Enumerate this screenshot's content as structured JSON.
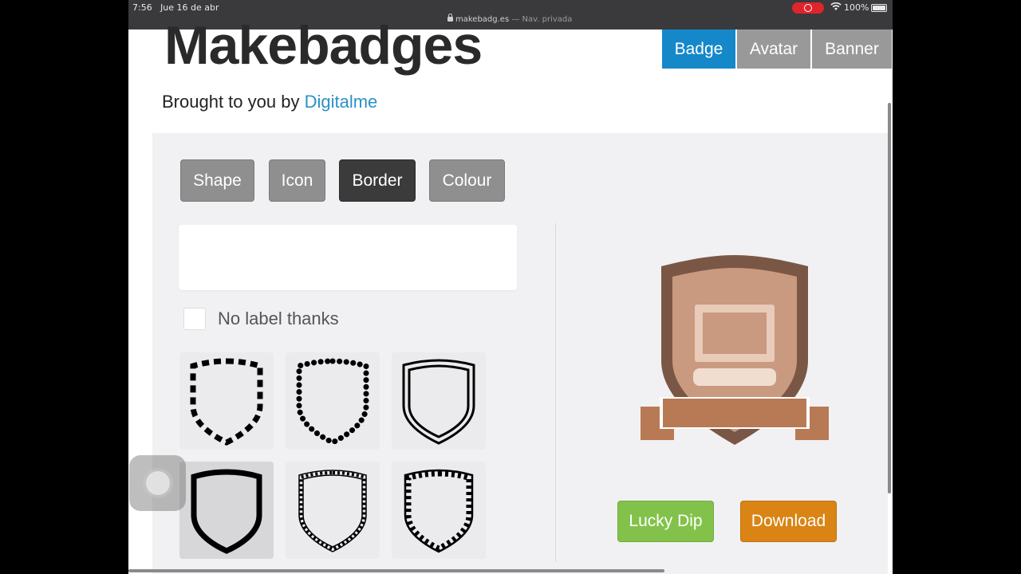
{
  "status_bar": {
    "time": "7:56",
    "date": "Jue 16 de abr",
    "url": "makebadg.es",
    "browse_mode": "— Nav. privada",
    "battery": "100%"
  },
  "site": {
    "logo": "Makebadges",
    "brought_prefix": "Brought to you by",
    "brought_link": "Digitalme",
    "link_color": "#2a92c6"
  },
  "top_nav": [
    {
      "label": "Badge",
      "active": true
    },
    {
      "label": "Avatar",
      "active": false
    },
    {
      "label": "Banner",
      "active": false
    }
  ],
  "editor_tabs": [
    {
      "label": "Shape",
      "active": false
    },
    {
      "label": "Icon",
      "active": false
    },
    {
      "label": "Border",
      "active": true
    },
    {
      "label": "Colour",
      "active": false
    }
  ],
  "label_field": {
    "value": "",
    "placeholder": ""
  },
  "no_label": {
    "label": "No label thanks",
    "checked": false
  },
  "border_options": [
    {
      "style": "dashed-border",
      "selected": false
    },
    {
      "style": "dotted-border",
      "selected": false
    },
    {
      "style": "double-line-border",
      "selected": false
    },
    {
      "style": "thick-border",
      "selected": true
    },
    {
      "style": "diamond-chain-border",
      "selected": false
    },
    {
      "style": "zigzag-border",
      "selected": false
    }
  ],
  "preview": {
    "shape": "shield",
    "icon": "computer-icon",
    "border_color": "#7a5745",
    "fill_color": "#c99a80",
    "banner_color": "#b87a55"
  },
  "actions": {
    "lucky_dip": "Lucky Dip",
    "download": "Download"
  },
  "colors": {
    "accent": "#1588c9",
    "lucky_dip": "#82c24a",
    "download": "#d98414"
  }
}
